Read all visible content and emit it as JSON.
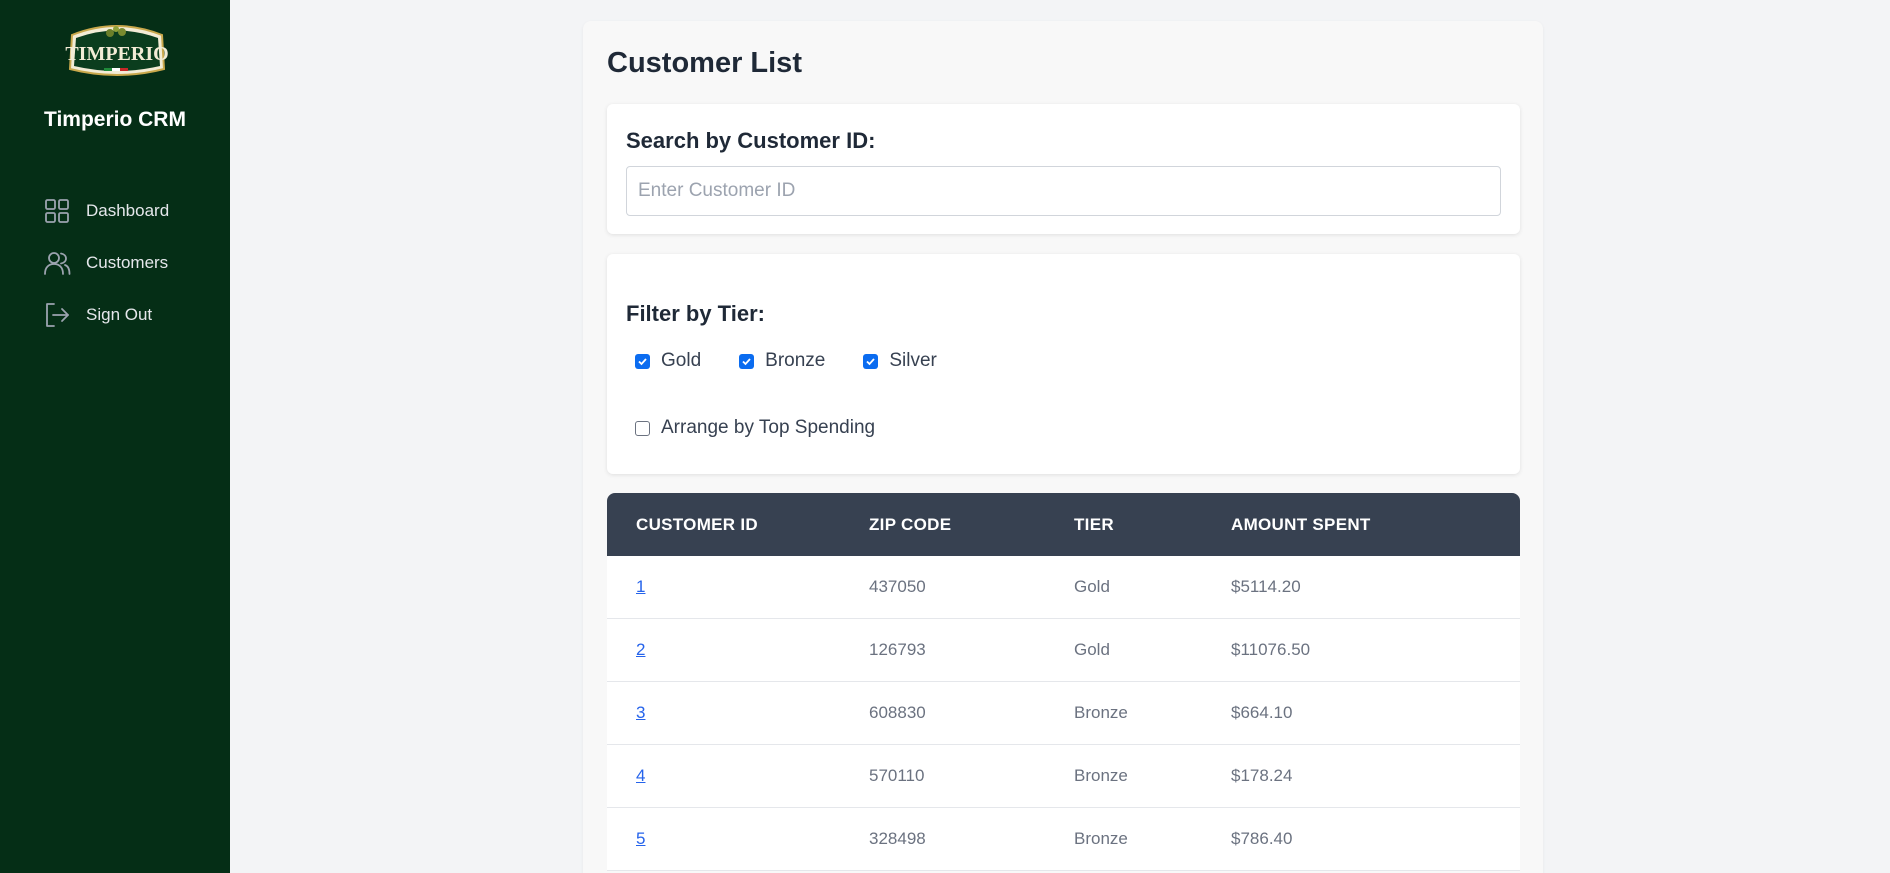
{
  "sidebar": {
    "logo_text": "TIMPERIO",
    "app_name": "Timperio CRM",
    "items": [
      {
        "label": "Dashboard",
        "icon": "dashboard-grid-icon"
      },
      {
        "label": "Customers",
        "icon": "users-icon"
      },
      {
        "label": "Sign Out",
        "icon": "sign-out-icon"
      }
    ]
  },
  "main": {
    "title": "Customer List",
    "search": {
      "label": "Search by Customer ID:",
      "placeholder": "Enter Customer ID",
      "value": ""
    },
    "filter": {
      "label": "Filter by Tier:",
      "tiers": [
        {
          "label": "Gold",
          "checked": true
        },
        {
          "label": "Bronze",
          "checked": true
        },
        {
          "label": "Silver",
          "checked": true
        }
      ],
      "arrange": {
        "label": "Arrange by Top Spending",
        "checked": false
      }
    },
    "table": {
      "headers": [
        "CUSTOMER ID",
        "ZIP CODE",
        "TIER",
        "AMOUNT SPENT"
      ],
      "rows": [
        {
          "id": "1",
          "zip": "437050",
          "tier": "Gold",
          "amount": "$5114.20"
        },
        {
          "id": "2",
          "zip": "126793",
          "tier": "Gold",
          "amount": "$11076.50"
        },
        {
          "id": "3",
          "zip": "608830",
          "tier": "Bronze",
          "amount": "$664.10"
        },
        {
          "id": "4",
          "zip": "570110",
          "tier": "Bronze",
          "amount": "$178.24"
        },
        {
          "id": "5",
          "zip": "328498",
          "tier": "Bronze",
          "amount": "$786.40"
        }
      ]
    }
  },
  "colors": {
    "sidebar_bg": "#052e16",
    "table_header_bg": "#374151",
    "checkbox_accent": "#0b6cf0",
    "link": "#2563eb"
  }
}
